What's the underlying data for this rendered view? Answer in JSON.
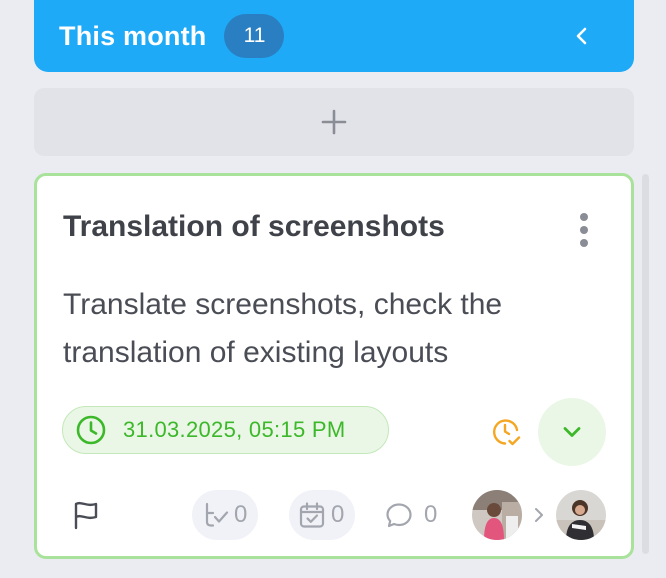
{
  "header": {
    "title": "This month",
    "count": "11"
  },
  "task": {
    "title": "Translation of screenshots",
    "description": "Translate screenshots, check the translation of existing layouts",
    "due_date": "31.03.2025, 05:15 PM",
    "subtasks_count": "0",
    "events_count": "0",
    "comments_count": "0"
  },
  "colors": {
    "accent": "#1eaaf6",
    "count_badge": "#2a7fc2",
    "card_border": "#a9e29a",
    "due_green": "#3cb82a",
    "time_status_orange": "#f5a623",
    "muted_icon": "#a3a6ae"
  },
  "icons": {
    "collapse": "chevron-left-icon",
    "add": "plus-icon",
    "more": "more-vertical-icon",
    "due": "clock-icon",
    "time_status": "clock-check-icon",
    "expand": "chevron-down-icon",
    "priority": "flag-icon",
    "subtasks": "subtasks-icon",
    "events": "calendar-check-icon",
    "comments": "comment-icon",
    "assign_arrow": "chevron-right-icon"
  }
}
